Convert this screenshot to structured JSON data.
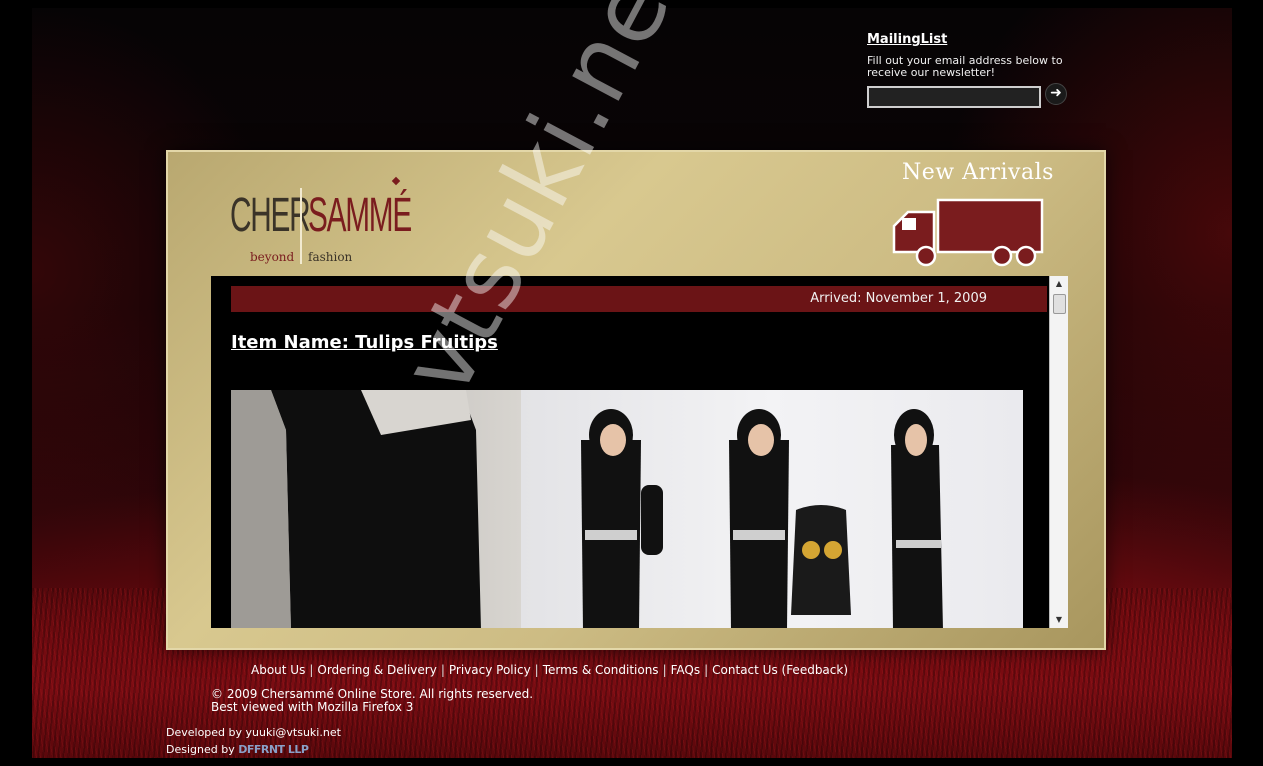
{
  "mailing": {
    "title": "MailingList",
    "description": "Fill out your email address below to receive our newsletter!",
    "input_value": "",
    "submit_icon": "arrow-right-icon"
  },
  "header": {
    "logo": {
      "cher": "CHER",
      "samme": "SAMMÉ",
      "beyond": "beyond",
      "fashion": "fashion"
    },
    "new_arrivals": "New Arrivals",
    "truck_icon": "truck-icon"
  },
  "item": {
    "arrived": "Arrived: November 1, 2009",
    "name": "Item Name: Tulips Fruitips"
  },
  "watermark": "vtsuki.net",
  "footer": {
    "links": [
      "About Us",
      "Ordering & Delivery",
      "Privacy Policy",
      "Terms & Conditions",
      "FAQs",
      "Contact Us (Feedback)"
    ],
    "copyright": "© 2009 Chersammé Online Store. All rights reserved.",
    "best_viewed": "Best viewed with Mozilla Firefox 3",
    "developed_by": "Developed by yuuki@vtsuki.net",
    "designed_by_label": "Designed by",
    "designed_by_brand": "DFFRNT LLP"
  },
  "colors": {
    "accent_red": "#6b1416",
    "gold": "#cdbc84"
  }
}
